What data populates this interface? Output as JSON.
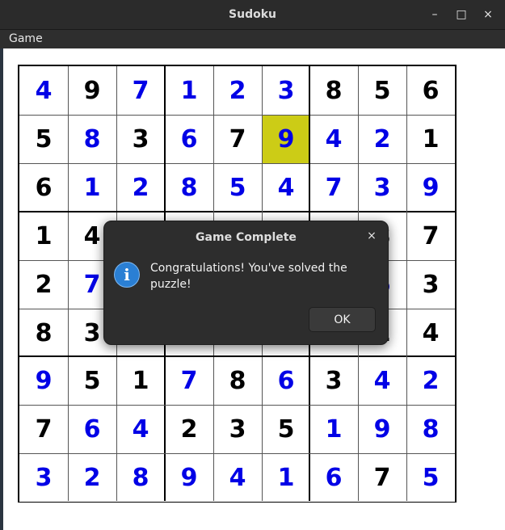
{
  "window": {
    "title": "Sudoku",
    "minimize_glyph": "–",
    "maximize_glyph": "□",
    "close_glyph": "×"
  },
  "menubar": {
    "game_label": "Game"
  },
  "board": {
    "highlight_color": "#cccc16",
    "fixed_color": "#000000",
    "entered_color": "#0000e6",
    "selected": [
      1,
      5
    ],
    "rows": [
      [
        {
          "v": "4",
          "t": "e"
        },
        {
          "v": "9",
          "t": "f"
        },
        {
          "v": "7",
          "t": "e"
        },
        {
          "v": "1",
          "t": "e"
        },
        {
          "v": "2",
          "t": "e"
        },
        {
          "v": "3",
          "t": "e"
        },
        {
          "v": "8",
          "t": "f"
        },
        {
          "v": "5",
          "t": "f"
        },
        {
          "v": "6",
          "t": "f"
        }
      ],
      [
        {
          "v": "5",
          "t": "f"
        },
        {
          "v": "8",
          "t": "e"
        },
        {
          "v": "3",
          "t": "f"
        },
        {
          "v": "6",
          "t": "e"
        },
        {
          "v": "7",
          "t": "f"
        },
        {
          "v": "9",
          "t": "e"
        },
        {
          "v": "4",
          "t": "e"
        },
        {
          "v": "2",
          "t": "e"
        },
        {
          "v": "1",
          "t": "f"
        }
      ],
      [
        {
          "v": "6",
          "t": "f"
        },
        {
          "v": "1",
          "t": "e"
        },
        {
          "v": "2",
          "t": "e"
        },
        {
          "v": "8",
          "t": "e"
        },
        {
          "v": "5",
          "t": "e"
        },
        {
          "v": "4",
          "t": "e"
        },
        {
          "v": "7",
          "t": "e"
        },
        {
          "v": "3",
          "t": "e"
        },
        {
          "v": "9",
          "t": "e"
        }
      ],
      [
        {
          "v": "1",
          "t": "f"
        },
        {
          "v": "4",
          "t": "f"
        },
        {
          "v": "",
          "t": "f"
        },
        {
          "v": "",
          "t": "f"
        },
        {
          "v": "",
          "t": "f"
        },
        {
          "v": "",
          "t": "f"
        },
        {
          "v": "",
          "t": "f"
        },
        {
          "v": "8",
          "t": "f"
        },
        {
          "v": "7",
          "t": "f"
        }
      ],
      [
        {
          "v": "2",
          "t": "f"
        },
        {
          "v": "7",
          "t": "e"
        },
        {
          "v": "",
          "t": "f"
        },
        {
          "v": "",
          "t": "f"
        },
        {
          "v": "",
          "t": "f"
        },
        {
          "v": "",
          "t": "f"
        },
        {
          "v": "",
          "t": "f"
        },
        {
          "v": "6",
          "t": "e"
        },
        {
          "v": "3",
          "t": "f"
        }
      ],
      [
        {
          "v": "8",
          "t": "f"
        },
        {
          "v": "3",
          "t": "f"
        },
        {
          "v": "",
          "t": "f"
        },
        {
          "v": "",
          "t": "f"
        },
        {
          "v": "",
          "t": "f"
        },
        {
          "v": "",
          "t": "f"
        },
        {
          "v": "",
          "t": "f"
        },
        {
          "v": "1",
          "t": "f"
        },
        {
          "v": "4",
          "t": "f"
        }
      ],
      [
        {
          "v": "9",
          "t": "e"
        },
        {
          "v": "5",
          "t": "f"
        },
        {
          "v": "1",
          "t": "f"
        },
        {
          "v": "7",
          "t": "e"
        },
        {
          "v": "8",
          "t": "f"
        },
        {
          "v": "6",
          "t": "e"
        },
        {
          "v": "3",
          "t": "f"
        },
        {
          "v": "4",
          "t": "e"
        },
        {
          "v": "2",
          "t": "e"
        }
      ],
      [
        {
          "v": "7",
          "t": "f"
        },
        {
          "v": "6",
          "t": "e"
        },
        {
          "v": "4",
          "t": "e"
        },
        {
          "v": "2",
          "t": "f"
        },
        {
          "v": "3",
          "t": "f"
        },
        {
          "v": "5",
          "t": "f"
        },
        {
          "v": "1",
          "t": "e"
        },
        {
          "v": "9",
          "t": "e"
        },
        {
          "v": "8",
          "t": "e"
        }
      ],
      [
        {
          "v": "3",
          "t": "e"
        },
        {
          "v": "2",
          "t": "e"
        },
        {
          "v": "8",
          "t": "e"
        },
        {
          "v": "9",
          "t": "e"
        },
        {
          "v": "4",
          "t": "e"
        },
        {
          "v": "1",
          "t": "e"
        },
        {
          "v": "6",
          "t": "e"
        },
        {
          "v": "7",
          "t": "f"
        },
        {
          "v": "5",
          "t": "e"
        }
      ]
    ]
  },
  "dialog": {
    "title": "Game Complete",
    "close_glyph": "×",
    "icon": "info-icon",
    "icon_glyph": "i",
    "message": "Congratulations! You've solved the puzzle!",
    "ok_label": "OK"
  }
}
